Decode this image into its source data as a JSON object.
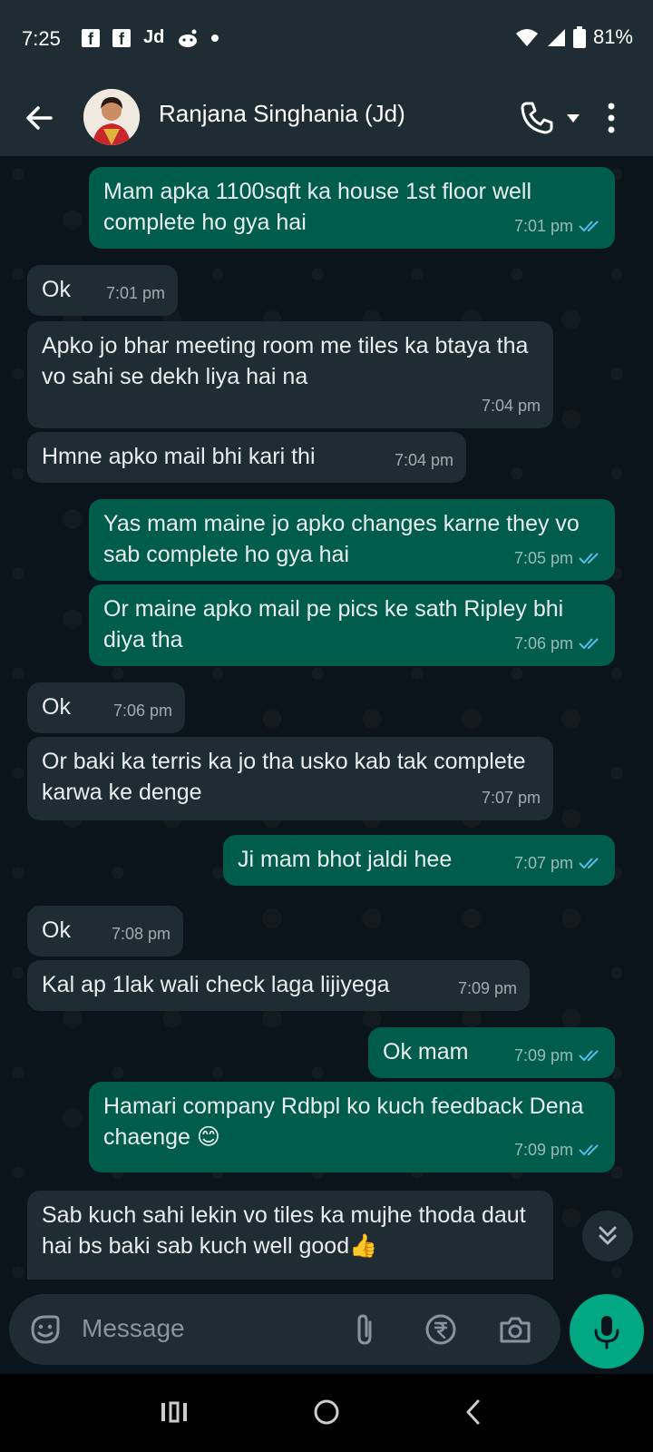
{
  "status_bar": {
    "time": "7:25",
    "notif_fb1": "f",
    "notif_fb2": "f",
    "notif_jd": "Jd",
    "battery": "81%"
  },
  "header": {
    "contact_name": "Ranjana Singhania (Jd)"
  },
  "messages": [
    {
      "dir": "out",
      "text": "Mam apka 1100sqft ka house 1st floor well complete ho gya hai",
      "time": "7:01 pm"
    },
    {
      "dir": "in",
      "text": "Ok",
      "time": "7:01 pm"
    },
    {
      "dir": "in",
      "text": "Apko jo bhar meeting room me tiles ka btaya tha vo sahi se dekh liya hai na",
      "time": "7:04 pm"
    },
    {
      "dir": "in",
      "text": "Hmne apko mail bhi kari thi",
      "time": "7:04 pm"
    },
    {
      "dir": "out",
      "text": "Yas mam maine jo apko changes karne they vo sab complete ho gya hai",
      "time": "7:05 pm"
    },
    {
      "dir": "out",
      "text": "Or maine apko mail pe pics ke sath Ripley bhi diya tha",
      "time": "7:06 pm"
    },
    {
      "dir": "in",
      "text": "Ok",
      "time": "7:06 pm"
    },
    {
      "dir": "in",
      "text": "Or baki ka terris ka jo tha usko kab tak complete karwa ke denge",
      "time": "7:07 pm"
    },
    {
      "dir": "out",
      "text": "Ji mam bhot jaldi hee",
      "time": "7:07 pm"
    },
    {
      "dir": "in",
      "text": "Ok",
      "time": "7:08 pm"
    },
    {
      "dir": "in",
      "text": "Kal ap 1lak wali check laga lijiyega",
      "time": "7:09 pm"
    },
    {
      "dir": "out",
      "text": "Ok mam",
      "time": "7:09 pm"
    },
    {
      "dir": "out",
      "text": "Hamari company Rdbpl ko kuch feedback Dena chaenge 😊",
      "time": "7:09 pm"
    },
    {
      "dir": "in",
      "text": "Sab kuch sahi lekin vo tiles ka mujhe thoda daut hai bs baki sab kuch well good👍",
      "time": ""
    }
  ],
  "composer": {
    "placeholder": "Message"
  }
}
